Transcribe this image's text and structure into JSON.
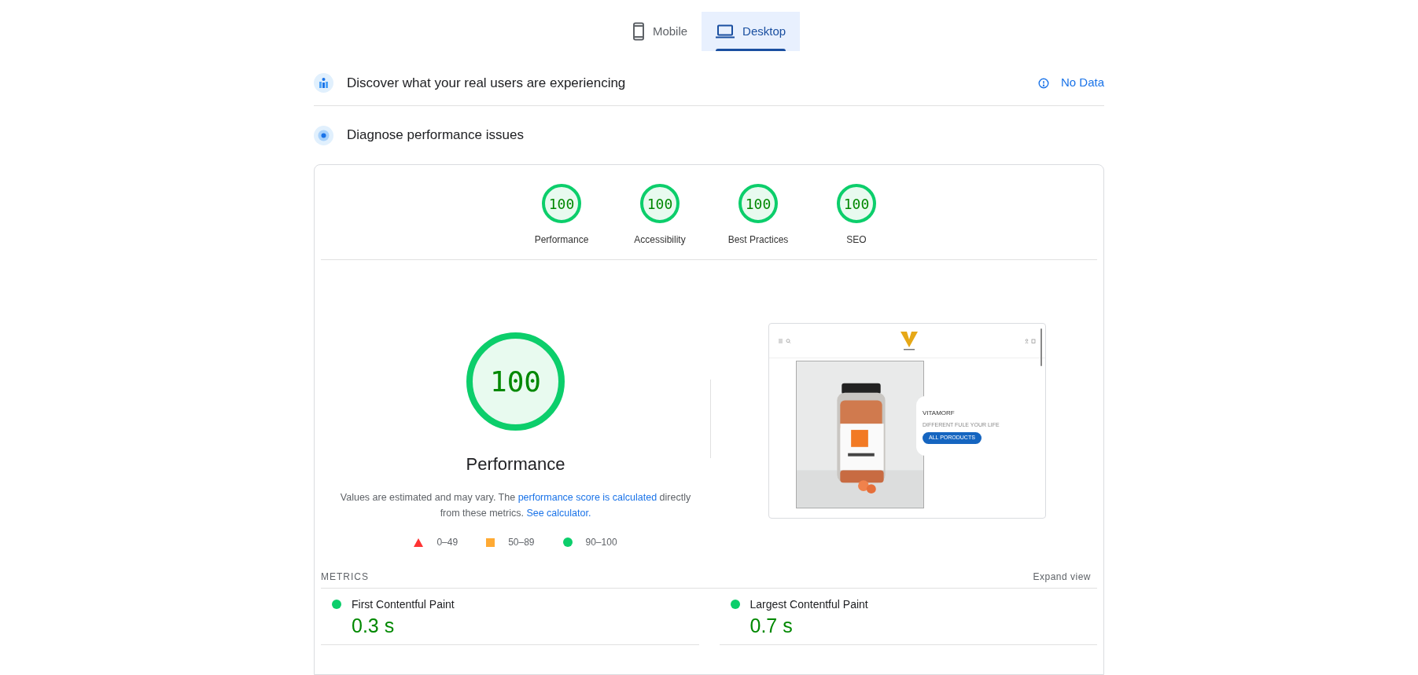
{
  "tabs": [
    {
      "label": "Mobile",
      "kind": "mobile",
      "selected": false
    },
    {
      "label": "Desktop",
      "kind": "desktop",
      "selected": true
    }
  ],
  "field_data": {
    "title": "Discover what your real users are experiencing",
    "status": "No Data"
  },
  "diagnose": {
    "title": "Diagnose performance issues"
  },
  "scores": [
    {
      "score": "100",
      "label": "Performance",
      "color": "#0cce6b"
    },
    {
      "score": "100",
      "label": "Accessibility",
      "color": "#0cce6b"
    },
    {
      "score": "100",
      "label": "Best Practices",
      "color": "#0cce6b"
    },
    {
      "score": "100",
      "label": "SEO",
      "color": "#0cce6b"
    }
  ],
  "main_score": {
    "score": "100",
    "label": "Performance",
    "color": "#0cce6b"
  },
  "description": {
    "before": "Values are estimated and may vary. The ",
    "link": "performance score is calculated",
    "middle": " directly from these metrics. ",
    "link2": "See calculator."
  },
  "legend": [
    {
      "kind": "triangle",
      "range": "0–49",
      "color": "#ff3333"
    },
    {
      "kind": "square",
      "range": "50–89",
      "color": "#ffaa33"
    },
    {
      "kind": "circle",
      "range": "90–100",
      "color": "#0cce6b"
    }
  ],
  "screenshot": {
    "brand": "VITAMORF",
    "tagline": "DIFFERENT FULE YOUR LIFE",
    "button": "ALL PORODUCTS"
  },
  "metrics": {
    "heading": "METRICS",
    "expand": "Expand view",
    "items": [
      {
        "name": "First Contentful Paint",
        "value": "0.3 s",
        "color": "#0cce6b"
      },
      {
        "name": "Largest Contentful Paint",
        "value": "0.7 s",
        "color": "#0cce6b"
      }
    ]
  }
}
